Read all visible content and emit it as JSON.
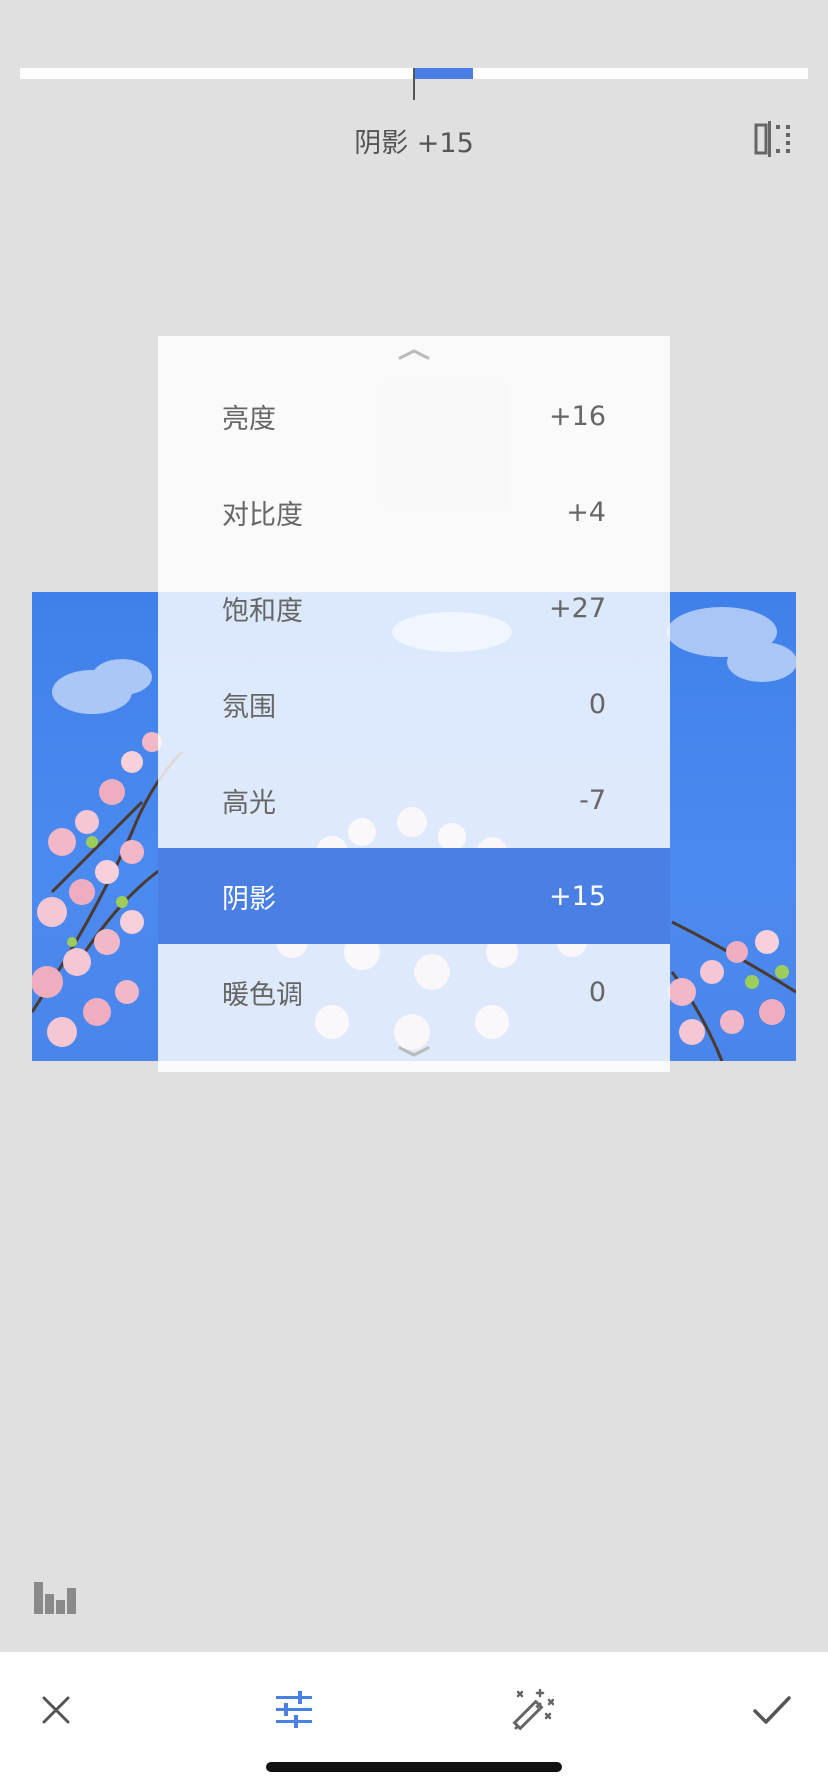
{
  "adjustment": {
    "caption": "阴影 +15",
    "slider_value_percent": 15
  },
  "icons": {
    "compare": "compare-split-icon",
    "histogram": "histogram-icon",
    "cancel": "close-icon",
    "tune": "tune-sliders-icon",
    "auto": "magic-wand-icon",
    "confirm": "checkmark-icon",
    "scroll_up": "chevron-up-icon",
    "scroll_down": "chevron-down-icon"
  },
  "colors": {
    "accent": "#4a7fe3",
    "background": "#e0e0e0"
  },
  "adjust_list": [
    {
      "label": "亮度",
      "value": "+16",
      "selected": false
    },
    {
      "label": "对比度",
      "value": "+4",
      "selected": false
    },
    {
      "label": "饱和度",
      "value": "+27",
      "selected": false
    },
    {
      "label": "氛围",
      "value": "0",
      "selected": false
    },
    {
      "label": "高光",
      "value": "-7",
      "selected": false
    },
    {
      "label": "阴影",
      "value": "+15",
      "selected": true
    },
    {
      "label": "暖色调",
      "value": "0",
      "selected": false
    }
  ]
}
